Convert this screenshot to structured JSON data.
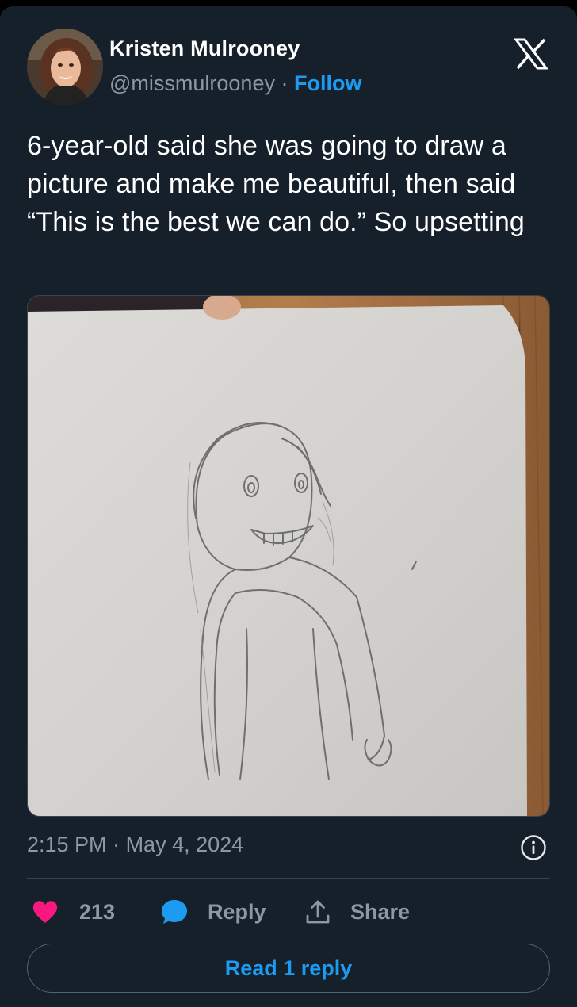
{
  "author": {
    "name": "Kristen Mulrooney",
    "handle": "@missmulrooney",
    "separator": " · ",
    "follow_label": "Follow"
  },
  "tweet": {
    "text": "6-year-old said she was going to draw a picture and make me beautiful, then said “This is the best we can do.” So upsetting"
  },
  "meta": {
    "time": "2:15 PM",
    "separator": " · ",
    "date": "May 4, 2024"
  },
  "actions": {
    "like_count": "213",
    "reply_label": "Reply",
    "share_label": "Share"
  },
  "read_replies_label": "Read 1 reply",
  "colors": {
    "background": "#15202b",
    "accent": "#1d9bf0",
    "like": "#f91880",
    "text_secondary": "#8b98a5"
  },
  "icons": {
    "brand": "x-logo-icon",
    "info": "info-icon",
    "like": "heart-icon",
    "reply": "speech-bubble-icon",
    "share": "upload-icon"
  }
}
